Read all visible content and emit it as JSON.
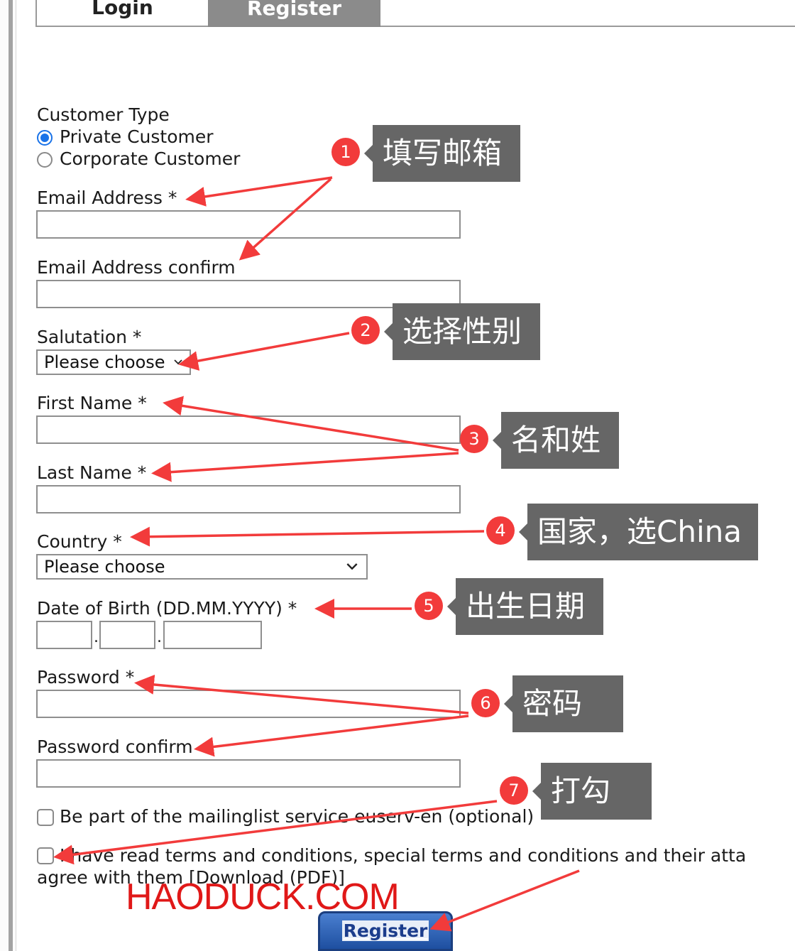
{
  "tabs": {
    "login": "Login",
    "register": "Register"
  },
  "form": {
    "customer_type_label": "Customer Type",
    "customer_types": [
      "Private Customer",
      "Corporate Customer"
    ],
    "selected_customer_type": "Private Customer",
    "email_label": "Email Address *",
    "email_value": "",
    "email_confirm_label": "Email Address confirm",
    "email_confirm_value": "",
    "salutation_label": "Salutation *",
    "salutation_value": "Please choose",
    "first_name_label": "First Name *",
    "last_name_label": "Last Name *",
    "country_label": "Country *",
    "country_value": "Please choose",
    "dob_label": "Date of Birth (DD.MM.YYYY) *",
    "dob_separator": ".",
    "password_label": "Password *",
    "password_confirm_label": "Password confirm",
    "mailinglist_label": "Be part of the mailinglist service euserv-en (optional)",
    "mailinglist_checked": false,
    "terms_label_line1": "I have read terms and conditions, special terms and conditions and their atta",
    "terms_label_line2": "agree with them [Download (PDF)]",
    "terms_checked": false,
    "register_button": "Register"
  },
  "annotations": [
    {
      "number": "1",
      "text": "填写邮箱"
    },
    {
      "number": "2",
      "text": "选择性别"
    },
    {
      "number": "3",
      "text": "名和姓"
    },
    {
      "number": "4",
      "text": "国家，选China"
    },
    {
      "number": "5",
      "text": "出生日期"
    },
    {
      "number": "6",
      "text": "密码"
    },
    {
      "number": "7",
      "text": "打勾"
    }
  ],
  "watermark": "HAODUCK.COM",
  "colors": {
    "annotation_red": "#f23b3b",
    "note_bg": "#666666",
    "radio_blue": "#1a73e8",
    "button_blue": "#1e4fa0"
  }
}
